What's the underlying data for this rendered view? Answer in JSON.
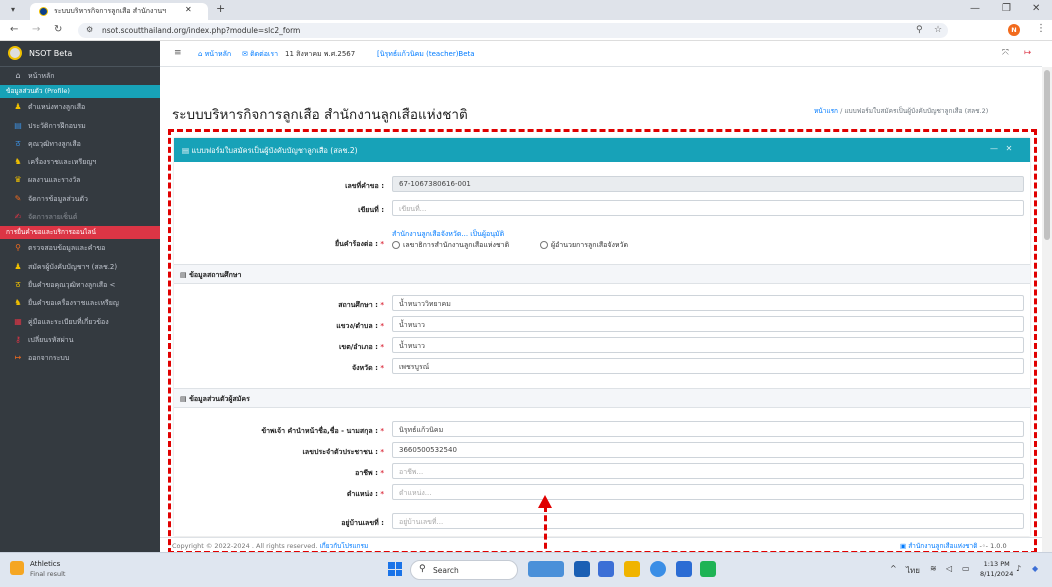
{
  "browser": {
    "tab_title": "ระบบบริหารกิจการลูกเสือ สำนักงานฯ",
    "url": "nsot.scoutthailand.org/index.php?module=slc2_form"
  },
  "sidebar": {
    "brand": "NSOT Beta",
    "items": [
      {
        "label": "หน้าหลัก",
        "icon": "home-icon",
        "glyph": "⌂",
        "color": "#c2c7d0",
        "style": ""
      },
      {
        "label": "ข้อมูลส่วนตัว (Profile)",
        "icon": "",
        "glyph": "",
        "color": "#ffffff",
        "style": "cyan"
      },
      {
        "label": "ตำแหน่งทางลูกเสือ",
        "icon": "users-icon",
        "glyph": "♟",
        "color": "#f0c000",
        "style": ""
      },
      {
        "label": "ประวัติการฝึกอบรม",
        "icon": "id-card-icon",
        "glyph": "▤",
        "color": "#3b8bd9",
        "style": ""
      },
      {
        "label": "คุณวุฒิทางลูกเสือ",
        "icon": "badge-icon",
        "glyph": "ठ",
        "color": "#3b8bd9",
        "style": ""
      },
      {
        "label": "เครื่องราชและเหรียญฯ",
        "icon": "ribbon-icon",
        "glyph": "♞",
        "color": "#f0c000",
        "style": ""
      },
      {
        "label": "ผลงานและรางวัล",
        "icon": "trophy-icon",
        "glyph": "♛",
        "color": "#f0c000",
        "style": ""
      },
      {
        "label": "จัดการข้อมูลส่วนตัว",
        "icon": "user-edit-icon",
        "glyph": "✎",
        "color": "#f26b1d",
        "style": ""
      },
      {
        "label": "จัดการลายเซ็นต์",
        "icon": "signature-icon",
        "glyph": "✍",
        "color": "#dc3545",
        "style": "muted"
      },
      {
        "label": "การยื่นคำขอและบริการออนไลน์",
        "icon": "",
        "glyph": "",
        "color": "#ffffff",
        "style": "red"
      },
      {
        "label": "ตรวจสอบข้อมูลและคำขอ",
        "icon": "search-icon",
        "glyph": "⚲",
        "color": "#f26b1d",
        "style": ""
      },
      {
        "label": "สมัครผู้บังคับบัญชาฯ (สลช.2)",
        "icon": "users-icon",
        "glyph": "♟",
        "color": "#f0c000",
        "style": ""
      },
      {
        "label": "ยื่นคำขอคุณวุฒิทางลูกเสือ  <",
        "icon": "badge-icon",
        "glyph": "ठ",
        "color": "#f0c000",
        "style": ""
      },
      {
        "label": "ยื่นคำขอเครื่องราชและเหรียญ",
        "icon": "ribbon-icon",
        "glyph": "♞",
        "color": "#f0c000",
        "style": ""
      },
      {
        "label": "คู่มือและระเบียบที่เกี่ยวข้อง",
        "icon": "book-icon",
        "glyph": "▦",
        "color": "#dc3545",
        "style": ""
      },
      {
        "label": "เปลี่ยนรหัสผ่าน",
        "icon": "key-icon",
        "glyph": "⚷",
        "color": "#dc3545",
        "style": ""
      },
      {
        "label": "ออกจากระบบ",
        "icon": "logout-icon",
        "glyph": "↦",
        "color": "#f26b1d",
        "style": ""
      }
    ]
  },
  "topnav": {
    "home": "หน้าหลัก",
    "contact": "ติดต่อเรา",
    "date": "11 สิงหาคม พ.ศ.2567",
    "user": "[นิรุทธ์แก้วนิคม (teacher)Beta"
  },
  "header": {
    "title": "ระบบบริหารกิจการลูกเสือ สำนักงานลูกเสือแห่งชาติ",
    "crumb_home": "หน้าแรก",
    "crumb_sep": " / ",
    "crumb_current": "แบบฟอร์มใบสมัครเป็นผู้บังคับบัญชาลูกเสือ (สลช.2)"
  },
  "form": {
    "card_title": "แบบฟอร์มใบสมัครเป็นผู้บังคับบัญชาลูกเสือ (สลช.2)",
    "request_no_label": "เลขที่คำขอ :",
    "request_no_value": "67-1067380616-001",
    "written_at_label": "เขียนที่ :",
    "written_at_placeholder": "เขียนที่...",
    "submit_to_label": "ยื่นคำร้องต่อ :",
    "submit_to_link": "สำนักงานลูกเสือจังหวัด... เป็นผู้อนุมัติ",
    "radio_1": "เลขาธิการสำนักงานลูกเสือแห่งชาติ",
    "radio_2": "ผู้อำนวยการลูกเสือจังหวัด",
    "section_school": "ข้อมูลสถานศึกษา",
    "school_label": "สถานศึกษา :",
    "school_value": "น้ำหนาววิทยาคม",
    "subdistrict_label": "แขวง/ตำบล :",
    "subdistrict_value": "น้ำหนาว",
    "district_label": "เขต/อำเภอ :",
    "district_value": "น้ำหนาว",
    "province_label": "จังหวัด :",
    "province_value": "เพชรบูรณ์",
    "section_personal": "ข้อมูลส่วนตัวผู้สมัคร",
    "name_label": "ข้าพเจ้า คำนำหน้าชื่อ,ชื่อ - นามสกุล :",
    "name_value": "นิรุทธ์แก้วนิคม",
    "idcard_label": "เลขประจำตัวประชาชน :",
    "idcard_value": "3660500532540",
    "job_label": "อาชีพ :",
    "job_placeholder": "อาชีพ...",
    "position_label": "ตำแหน่ง :",
    "position_placeholder": "ตำแหน่ง...",
    "house_label": "อยู่บ้านเลขที่ :",
    "house_placeholder": "อยู่บ้านเลขที่..."
  },
  "footer": {
    "copyright": "Copyright © 2022-2024 . All rights reserved.",
    "about": "เกี่ยวกับโปรแกรม",
    "org": "สำนักงานลูกเสือแห่งชาติ",
    "version": "1.0.0"
  },
  "taskbar": {
    "weather_title": "Athletics",
    "weather_sub": "Final result",
    "search": "Search",
    "lang": "ไทย",
    "time": "1:13 PM",
    "date": "8/11/2024"
  },
  "colors": {
    "accent_cyan": "#17a2b8",
    "accent_red": "#dc3545",
    "annotation": "#e00000"
  }
}
